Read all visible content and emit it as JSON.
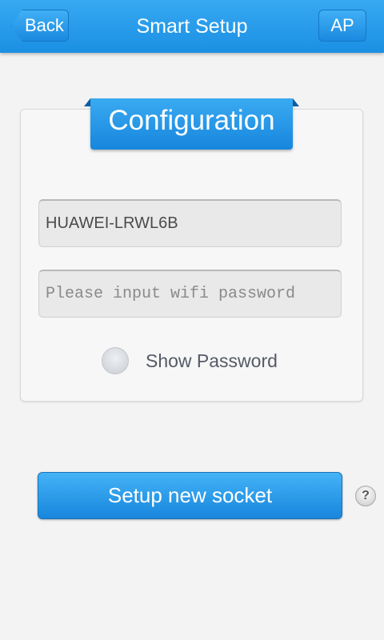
{
  "header": {
    "back_label": "Back",
    "title": "Smart Setup",
    "ap_label": "AP"
  },
  "config": {
    "title": "Configuration",
    "ssid_value": "HUAWEI-LRWL6B",
    "password_placeholder": "Please input wifi password",
    "show_password_label": "Show Password"
  },
  "actions": {
    "setup_label": "Setup new socket",
    "help_symbol": "?"
  },
  "colors": {
    "accent": "#1b8fe3",
    "background": "#f3f3f3"
  }
}
